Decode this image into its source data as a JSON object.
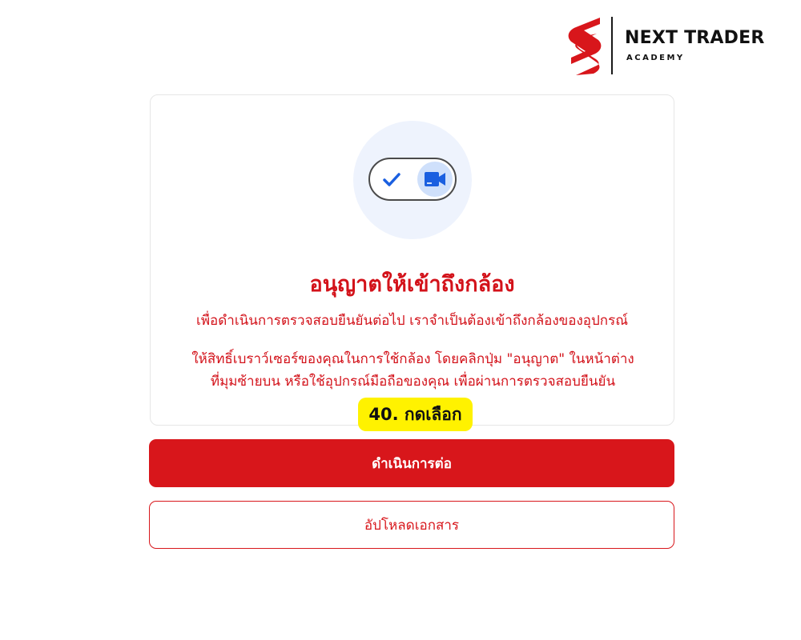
{
  "brand": {
    "title": "NEXT TRADER",
    "subtitle": "ACADEMY",
    "color": "#d8161b"
  },
  "permission_card": {
    "icon": "camera-toggle-icon",
    "title": "อนุญาตให้เข้าถึงกล้อง",
    "description": "เพื่อดำเนินการตรวจสอบยืนยันต่อไป เราจำเป็นต้องเข้าถึงกล้องของอุปกรณ์",
    "instruction_line1": "ให้สิทธิ์เบราว์เซอร์ของคุณในการใช้กล้อง โดยคลิกปุ่ม \"อนุญาต\" ในหน้าต่าง",
    "instruction_line2": "ที่มุมซ้ายบน หรือใช้อุปกรณ์มือถือของคุณ เพื่อผ่านการตรวจสอบยืนยัน"
  },
  "step_badge": {
    "label": "40. กดเลือก",
    "color": "#fff200"
  },
  "actions": {
    "continue_label": "ดำเนินการต่อ",
    "upload_label": "อัปโหลดเอกสาร"
  }
}
